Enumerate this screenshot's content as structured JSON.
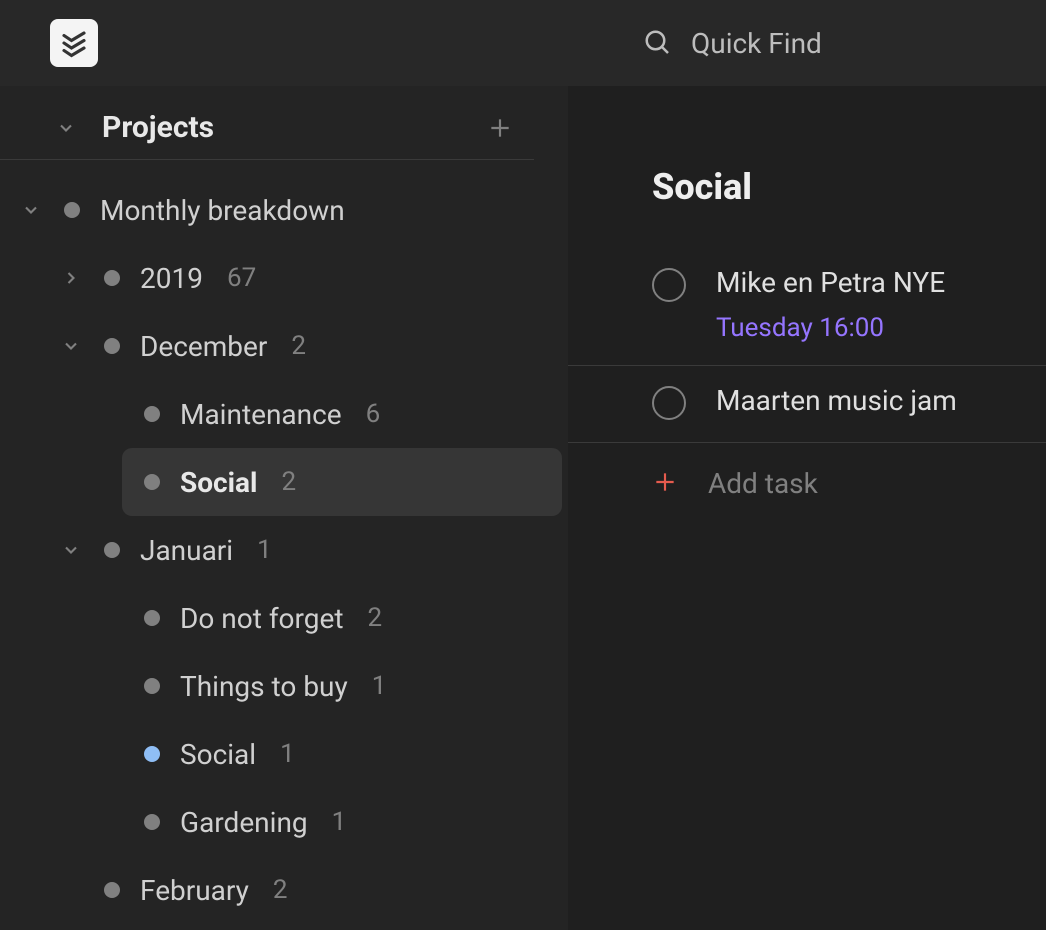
{
  "topbar": {
    "search_placeholder": "Quick Find"
  },
  "sidebar": {
    "section_title": "Projects",
    "tree": {
      "root": {
        "label": "Monthly breakdown"
      },
      "year": {
        "label": "2019",
        "count": "67"
      },
      "december": {
        "label": "December",
        "count": "2"
      },
      "maintenance": {
        "label": "Maintenance",
        "count": "6"
      },
      "social_dec": {
        "label": "Social",
        "count": "2"
      },
      "januari": {
        "label": "Januari",
        "count": "1"
      },
      "donotforget": {
        "label": "Do not forget",
        "count": "2"
      },
      "thingstobuy": {
        "label": "Things to buy",
        "count": "1"
      },
      "social_jan": {
        "label": "Social",
        "count": "1"
      },
      "gardening": {
        "label": "Gardening",
        "count": "1"
      },
      "february": {
        "label": "February",
        "count": "2"
      }
    }
  },
  "main": {
    "title": "Social",
    "tasks": [
      {
        "title": "Mike en Petra NYE",
        "due": "Tuesday 16:00"
      },
      {
        "title": "Maarten music jam",
        "due": ""
      }
    ],
    "add_task_label": "Add task"
  },
  "colors": {
    "accent_due": "#9575ff",
    "add_plus": "#e55b4e",
    "dot_blue": "#8fbef5"
  }
}
